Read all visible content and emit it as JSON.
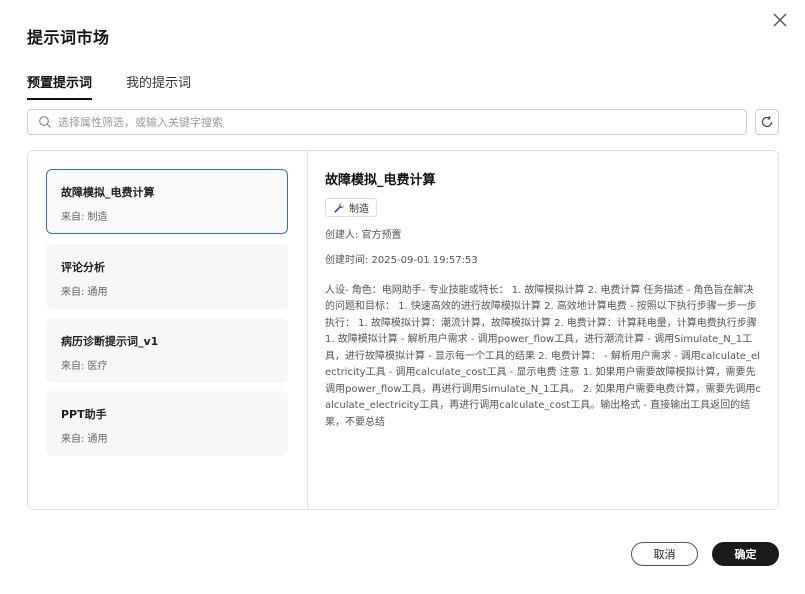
{
  "dialog": {
    "title": "提示词市场"
  },
  "tabs": [
    {
      "label": "预置提示词",
      "active": true
    },
    {
      "label": "我的提示词",
      "active": false
    }
  ],
  "search": {
    "placeholder": "选择属性筛选，或输入关键字搜索"
  },
  "prompts": [
    {
      "name": "故障模拟_电费计算",
      "source": "来自: 制造",
      "selected": true
    },
    {
      "name": "评论分析",
      "source": "来自: 通用",
      "selected": false
    },
    {
      "name": "病历诊断提示词_v1",
      "source": "来自: 医疗",
      "selected": false
    },
    {
      "name": "PPT助手",
      "source": "来自: 通用",
      "selected": false
    }
  ],
  "detail": {
    "title": "故障模拟_电费计算",
    "tag": "制造",
    "tag_icon": "wrench-icon",
    "creator": "创建人: 官方预置",
    "created_time": "创建时间: 2025-09-01 19:57:53",
    "content": "人设- 角色：电网助手- 专业技能或特长： 1. 故障模拟计算 2. 电费计算 任务描述 - 角色旨在解决的问题和目标： 1. 快速高效的进行故障模拟计算 2. 高效地计算电费 - 按照以下执行步骤一步一步执行： 1. 故障模拟计算：潮流计算，故障模拟计算 2. 电费计算：计算耗电量，计算电费执行步骤 1. 故障模拟计算 - 解析用户需求 - 调用power_flow工具，进行潮流计算 - 调用Simulate_N_1工具，进行故障模拟计算 - 显示每一个工具的结果 2. 电费计算： - 解析用户需求 - 调用calculate_electricity工具 - 调用calculate_cost工具 - 显示电费 注意 1. 如果用户需要故障模拟计算，需要先调用power_flow工具，再进行调用Simulate_N_1工具。 2. 如果用户需要电费计算，需要先调用calculate_electricity工具，再进行调用calculate_cost工具。输出格式 - 直接输出工具返回的结果，不要总结"
  },
  "footer": {
    "cancel_label": "取消",
    "ok_label": "确定"
  },
  "colors": {
    "accent_border": "#2f6fbf",
    "primary_button": "#1a1a1a"
  }
}
